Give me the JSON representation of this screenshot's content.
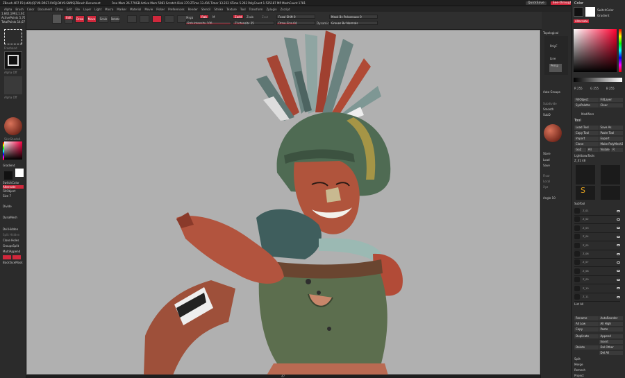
{
  "title": "ZBrush 4R7 P3 (x64)(Q7U9-DRS7-XVQJ-D4V9-SW9S)ZBrush Document",
  "memory_info": "Free Mem 26.779GB  Active Mem 5981  Scratch Disk 270  ZTime 13.416  Timer 13.222  ATime 5.262  PolyCount 1.525187 MP  MeshCount 1781",
  "quicksave": "QuickSave",
  "see_through": "See-through  0",
  "menus_label": "Menus",
  "defaultscript": "DefaultZScript",
  "menus": [
    "Alpha",
    "Brush",
    "Color",
    "Document",
    "Draw",
    "Edit",
    "File",
    "Layer",
    "Light",
    "Macro",
    "Marker",
    "Material",
    "Movie",
    "Picker",
    "Preferences",
    "Render",
    "Stencil",
    "Stroke",
    "Texture",
    "Tool",
    "Transform",
    "Zplugin",
    "Zscript"
  ],
  "toolbar": {
    "buttons": [
      "Edit",
      "Draw",
      "Move",
      "Scale",
      "Rotate"
    ],
    "mrgb": "Mrgb",
    "rgb": "Rgb",
    "m": "M",
    "rgb_intensity": "Rgb Intensity 100",
    "zadd": "Zadd",
    "zsub": "Zsub",
    "zcut": "Zcut",
    "z_intensity": "Z Intensity 25",
    "focal_shift": "Focal Shift 0",
    "draw_size": "Draw Size 64",
    "dynamic": "Dynamic",
    "mask_by_polygroups": "Mask By Polygroups 0",
    "groups_by_normals": "Groups By Normals"
  },
  "left_shelf": {
    "readout": "1.842,1992,1.611",
    "active_points": "ActivePoints 5,767 Mil",
    "total_points": "TotalPoints 14,675 Mil",
    "stroke_label": "Freehand",
    "alpha_label": "Alpha Off",
    "texture_label": "Texture Off",
    "material_label": "SkinShade4",
    "gradient": "Gradient",
    "switchcolor": "SwitchColor",
    "alternate": "Alternate",
    "fill_object": "FillObject",
    "slice": "Slice",
    "divide": "Divide",
    "dynamesh": "DynaMesh",
    "del_hidden": "Del Hidden",
    "split_hidden": "Split Hidden",
    "close_holes": "Close Holes",
    "groups_split": "GroupsSplit",
    "multi_append": "MultiAppend",
    "backface_mask": "BackfaceMask",
    "size": "Size 7"
  },
  "right_shelf": {
    "topological": "Topological",
    "polyframe": "PolyF",
    "line": "Line",
    "persp": "Persp",
    "floor": "Floor",
    "local": "Local",
    "xyz": "Xyz",
    "transp": "Transp",
    "solo": "Solo",
    "dynamic": "Dynamic",
    "auto_groups": "Auto Groups",
    "subdiv": "Subdivide",
    "smooth": "Smooth",
    "suv": "SubD",
    "store": "Store",
    "load": "Load",
    "save": "Save",
    "dynamic2": "Dynamic",
    "angle": "Angle 10"
  },
  "color_panel": {
    "header": "Color",
    "switchcolor": "SwitchColor",
    "gradient": "Gradient",
    "alternate": "Alternate",
    "r": "R 255",
    "g": "G 255",
    "b": "B 255",
    "fill_object": "FillObject",
    "fill_layer": "FillLayer",
    "sys_palette": "SysPalette",
    "clear": "Clear",
    "modifiers": "Modifiers"
  },
  "tool_panel": {
    "header": "Tool",
    "load_tool": "Load Tool",
    "save_as": "Save As",
    "copy_tool": "Copy Tool",
    "paste_tool": "Paste Tool",
    "import": "Import",
    "export": "Export",
    "clone": "Clone",
    "make_polymesh": "Make PolyMesh3D",
    "goz": "GoZ",
    "all": "All",
    "visible": "Visible",
    "r": "R",
    "lightbox_tools": "Lightbox▸Tools",
    "tool_name": "Z_01 48",
    "thumbs": [
      "Z_01",
      "Cylinder3D",
      "SimpleBrush",
      "PolyMesh3D",
      "Z_41"
    ],
    "subtool": "SubTool",
    "subtool_items": [
      "Z_01",
      "Z_02",
      "Z_03",
      "Z_04",
      "Z_05",
      "Z_06",
      "Z_07",
      "Z_08",
      "Z_09",
      "Z_10",
      "Z_11"
    ],
    "list_all": "List All",
    "rename": "Rename",
    "autoreorder": "AutoReorder",
    "all_low": "All Low",
    "all_high": "All High",
    "copy": "Copy",
    "paste": "Paste",
    "duplicate": "Duplicate",
    "append": "Append",
    "insert": "Insert",
    "delete": "Delete",
    "del_other": "Del Other",
    "del_all": "Del All",
    "split": "Split",
    "merge": "Merge",
    "remesh": "Remesh",
    "project": "Project"
  },
  "status": "47"
}
